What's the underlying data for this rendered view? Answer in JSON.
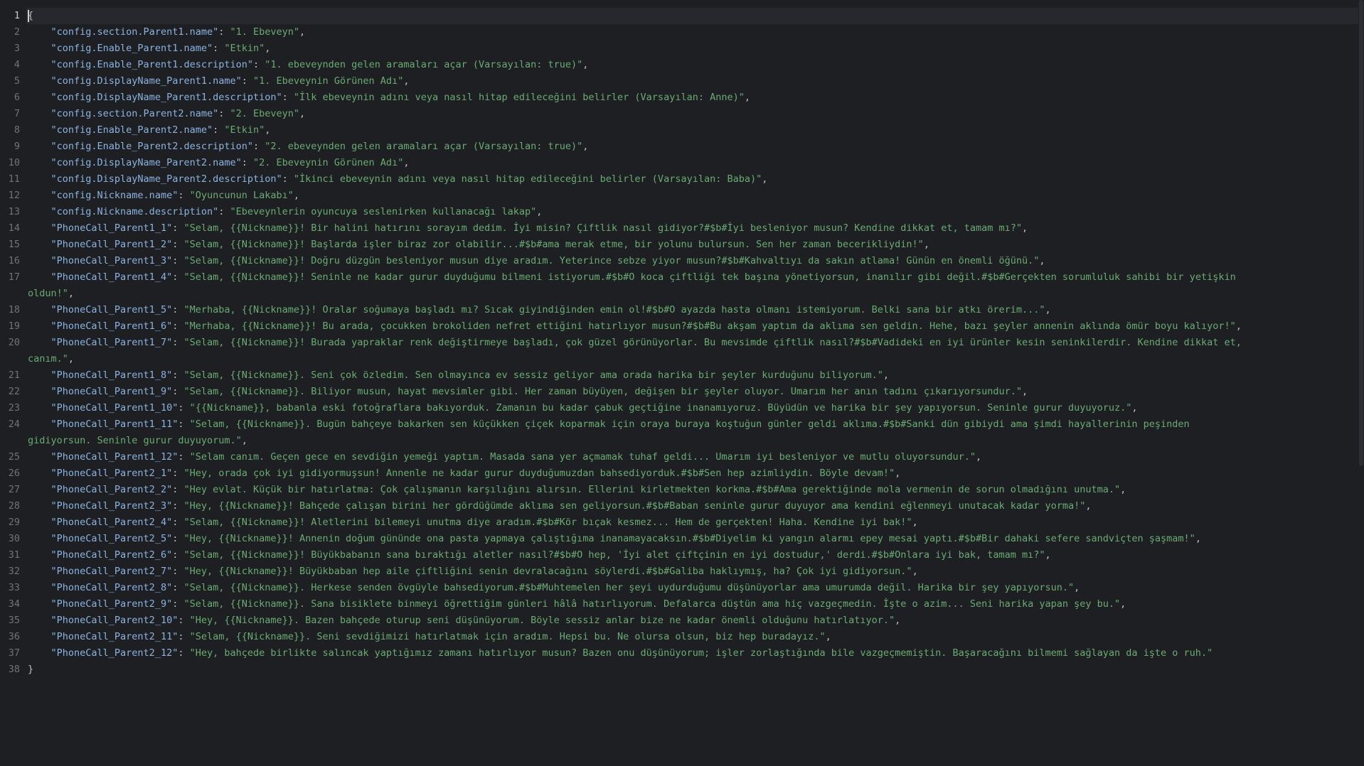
{
  "editor": {
    "lines": [
      {
        "n": "1",
        "indent": "",
        "open": "{"
      },
      {
        "n": "2",
        "indent": "    ",
        "key": "\"config.section.Parent1.name\"",
        "sep": ": ",
        "val": "\"1. Ebeveyn\"",
        "end": ","
      },
      {
        "n": "3",
        "indent": "    ",
        "key": "\"config.Enable_Parent1.name\"",
        "sep": ": ",
        "val": "\"Etkin\"",
        "end": ","
      },
      {
        "n": "4",
        "indent": "    ",
        "key": "\"config.Enable_Parent1.description\"",
        "sep": ": ",
        "val": "\"1. ebeveynden gelen aramaları açar (Varsayılan: true)\"",
        "end": ","
      },
      {
        "n": "5",
        "indent": "    ",
        "key": "\"config.DisplayName_Parent1.name\"",
        "sep": ": ",
        "val": "\"1. Ebeveynin Görünen Adı\"",
        "end": ","
      },
      {
        "n": "6",
        "indent": "    ",
        "key": "\"config.DisplayName_Parent1.description\"",
        "sep": ": ",
        "val": "\"İlk ebeveynin adını veya nasıl hitap edileceğini belirler (Varsayılan: Anne)\"",
        "end": ","
      },
      {
        "n": "7",
        "indent": "    ",
        "key": "\"config.section.Parent2.name\"",
        "sep": ": ",
        "val": "\"2. Ebeveyn\"",
        "end": ","
      },
      {
        "n": "8",
        "indent": "    ",
        "key": "\"config.Enable_Parent2.name\"",
        "sep": ": ",
        "val": "\"Etkin\"",
        "end": ","
      },
      {
        "n": "9",
        "indent": "    ",
        "key": "\"config.Enable_Parent2.description\"",
        "sep": ": ",
        "val": "\"2. ebeveynden gelen aramaları açar (Varsayılan: true)\"",
        "end": ","
      },
      {
        "n": "10",
        "indent": "    ",
        "key": "\"config.DisplayName_Parent2.name\"",
        "sep": ": ",
        "val": "\"2. Ebeveynin Görünen Adı\"",
        "end": ","
      },
      {
        "n": "11",
        "indent": "    ",
        "key": "\"config.DisplayName_Parent2.description\"",
        "sep": ": ",
        "val": "\"İkinci ebeveynin adını veya nasıl hitap edileceğini belirler (Varsayılan: Baba)\"",
        "end": ","
      },
      {
        "n": "12",
        "indent": "    ",
        "key": "\"config.Nickname.name\"",
        "sep": ": ",
        "val": "\"Oyuncunun Lakabı\"",
        "end": ","
      },
      {
        "n": "13",
        "indent": "    ",
        "key": "\"config.Nickname.description\"",
        "sep": ": ",
        "val": "\"Ebeveynlerin oyuncuya seslenirken kullanacağı lakap\"",
        "end": ","
      },
      {
        "n": "14",
        "indent": "    ",
        "key": "\"PhoneCall_Parent1_1\"",
        "sep": ": ",
        "val": "\"Selam, {{Nickname}}! Bir halini hatırını sorayım dedim. İyi misin? Çiftlik nasıl gidiyor?#$b#İyi besleniyor musun? Kendine dikkat et, tamam mı?\"",
        "end": ","
      },
      {
        "n": "15",
        "indent": "    ",
        "key": "\"PhoneCall_Parent1_2\"",
        "sep": ": ",
        "val": "\"Selam, {{Nickname}}! Başlarda işler biraz zor olabilir...#$b#ama merak etme, bir yolunu bulursun. Sen her zaman becerikliydin!\"",
        "end": ","
      },
      {
        "n": "16",
        "indent": "    ",
        "key": "\"PhoneCall_Parent1_3\"",
        "sep": ": ",
        "val": "\"Selam, {{Nickname}}! Doğru düzgün besleniyor musun diye aradım. Yeterince sebze yiyor musun?#$b#Kahvaltıyı da sakın atlama! Günün en önemli öğünü.\"",
        "end": ","
      },
      {
        "n": "17",
        "indent": "    ",
        "key": "\"PhoneCall_Parent1_4\"",
        "sep": ": ",
        "val": "\"Selam, {{Nickname}}! Seninle ne kadar gurur duyduğumu bilmeni istiyorum.#$b#O koca çiftliği tek başına yönetiyorsun, inanılır gibi değil.#$b#Gerçekten sorumluluk sahibi bir yetişkin",
        "end": ""
      },
      {
        "n": "",
        "indent": "",
        "cont": "oldun!\"",
        "end": ","
      },
      {
        "n": "18",
        "indent": "    ",
        "key": "\"PhoneCall_Parent1_5\"",
        "sep": ": ",
        "val": "\"Merhaba, {{Nickname}}! Oralar soğumaya başladı mı? Sıcak giyindiğinden emin ol!#$b#O ayazda hasta olmanı istemiyorum. Belki sana bir atkı örerim...\"",
        "end": ","
      },
      {
        "n": "19",
        "indent": "    ",
        "key": "\"PhoneCall_Parent1_6\"",
        "sep": ": ",
        "val": "\"Merhaba, {{Nickname}}! Bu arada, çocukken brokoliden nefret ettiğini hatırlıyor musun?#$b#Bu akşam yaptım da aklıma sen geldin. Hehe, bazı şeyler annenin aklında ömür boyu kalıyor!\"",
        "end": ","
      },
      {
        "n": "20",
        "indent": "    ",
        "key": "\"PhoneCall_Parent1_7\"",
        "sep": ": ",
        "val": "\"Selam, {{Nickname}}! Burada yapraklar renk değiştirmeye başladı, çok güzel görünüyorlar. Bu mevsimde çiftlik nasıl?#$b#Vadideki en iyi ürünler kesin seninkilerdir. Kendine dikkat et,",
        "end": ""
      },
      {
        "n": "",
        "indent": "",
        "cont": "canım.\"",
        "end": ","
      },
      {
        "n": "21",
        "indent": "    ",
        "key": "\"PhoneCall_Parent1_8\"",
        "sep": ": ",
        "val": "\"Selam, {{Nickname}}. Seni çok özledim. Sen olmayınca ev sessiz geliyor ama orada harika bir şeyler kurduğunu biliyorum.\"",
        "end": ","
      },
      {
        "n": "22",
        "indent": "    ",
        "key": "\"PhoneCall_Parent1_9\"",
        "sep": ": ",
        "val": "\"Selam, {{Nickname}}. Biliyor musun, hayat mevsimler gibi. Her zaman büyüyen, değişen bir şeyler oluyor. Umarım her anın tadını çıkarıyorsundur.\"",
        "end": ","
      },
      {
        "n": "23",
        "indent": "    ",
        "key": "\"PhoneCall_Parent1_10\"",
        "sep": ": ",
        "val": "\"{{Nickname}}, babanla eski fotoğraflara bakıyorduk. Zamanın bu kadar çabuk geçtiğine inanamıyoruz. Büyüdün ve harika bir şey yapıyorsun. Seninle gurur duyuyoruz.\"",
        "end": ","
      },
      {
        "n": "24",
        "indent": "    ",
        "key": "\"PhoneCall_Parent1_11\"",
        "sep": ": ",
        "val": "\"Selam, {{Nickname}}. Bugün bahçeye bakarken sen küçükken çiçek koparmak için oraya buraya koştuğun günler geldi aklıma.#$b#Sanki dün gibiydi ama şimdi hayallerinin peşinden",
        "end": ""
      },
      {
        "n": "",
        "indent": "",
        "cont": "gidiyorsun. Seninle gurur duyuyorum.\"",
        "end": ","
      },
      {
        "n": "25",
        "indent": "    ",
        "key": "\"PhoneCall_Parent1_12\"",
        "sep": ": ",
        "val": "\"Selam canım. Geçen gece en sevdiğin yemeği yaptım. Masada sana yer açmamak tuhaf geldi... Umarım iyi besleniyor ve mutlu oluyorsundur.\"",
        "end": ","
      },
      {
        "n": "26",
        "indent": "    ",
        "key": "\"PhoneCall_Parent2_1\"",
        "sep": ": ",
        "val": "\"Hey, orada çok iyi gidiyormuşsun! Annenle ne kadar gurur duyduğumuzdan bahsediyorduk.#$b#Sen hep azimliydin. Böyle devam!\"",
        "end": ","
      },
      {
        "n": "27",
        "indent": "    ",
        "key": "\"PhoneCall_Parent2_2\"",
        "sep": ": ",
        "val": "\"Hey evlat. Küçük bir hatırlatma: Çok çalışmanın karşılığını alırsın. Ellerini kirletmekten korkma.#$b#Ama gerektiğinde mola vermenin de sorun olmadığını unutma.\"",
        "end": ","
      },
      {
        "n": "28",
        "indent": "    ",
        "key": "\"PhoneCall_Parent2_3\"",
        "sep": ": ",
        "val": "\"Hey, {{Nickname}}! Bahçede çalışan birini her gördüğümde aklıma sen geliyorsun.#$b#Baban seninle gurur duyuyor ama kendini eğlenmeyi unutacak kadar yorma!\"",
        "end": ","
      },
      {
        "n": "29",
        "indent": "    ",
        "key": "\"PhoneCall_Parent2_4\"",
        "sep": ": ",
        "val": "\"Selam, {{Nickname}}! Aletlerini bilemeyi unutma diye aradım.#$b#Kör bıçak kesmez... Hem de gerçekten! Haha. Kendine iyi bak!\"",
        "end": ","
      },
      {
        "n": "30",
        "indent": "    ",
        "key": "\"PhoneCall_Parent2_5\"",
        "sep": ": ",
        "val": "\"Hey, {{Nickname}}! Annenin doğum gününde ona pasta yapmaya çalıştığıma inanamayacaksın.#$b#Diyelim ki yangın alarmı epey mesai yaptı.#$b#Bir dahaki sefere sandviçten şaşmam!\"",
        "end": ","
      },
      {
        "n": "31",
        "indent": "    ",
        "key": "\"PhoneCall_Parent2_6\"",
        "sep": ": ",
        "val": "\"Selam, {{Nickname}}! Büyükbabanın sana bıraktığı aletler nasıl?#$b#O hep, 'İyi alet çiftçinin en iyi dostudur,' derdi.#$b#Onlara iyi bak, tamam mı?\"",
        "end": ","
      },
      {
        "n": "32",
        "indent": "    ",
        "key": "\"PhoneCall_Parent2_7\"",
        "sep": ": ",
        "val": "\"Hey, {{Nickname}}! Büyükbaban hep aile çiftliğini senin devralacağını söylerdi.#$b#Galiba haklıymış, ha? Çok iyi gidiyorsun.\"",
        "end": ","
      },
      {
        "n": "33",
        "indent": "    ",
        "key": "\"PhoneCall_Parent2_8\"",
        "sep": ": ",
        "val": "\"Selam, {{Nickname}}. Herkese senden övgüyle bahsediyorum.#$b#Muhtemelen her şeyi uydurduğumu düşünüyorlar ama umurumda değil. Harika bir şey yapıyorsun.\"",
        "end": ","
      },
      {
        "n": "34",
        "indent": "    ",
        "key": "\"PhoneCall_Parent2_9\"",
        "sep": ": ",
        "val": "\"Selam, {{Nickname}}. Sana bisiklete binmeyi öğrettiğim günleri hâlâ hatırlıyorum. Defalarca düştün ama hiç vazgeçmedin. İşte o azim... Seni harika yapan şey bu.\"",
        "end": ","
      },
      {
        "n": "35",
        "indent": "    ",
        "key": "\"PhoneCall_Parent2_10\"",
        "sep": ": ",
        "val": "\"Hey, {{Nickname}}. Bazen bahçede oturup seni düşünüyorum. Böyle sessiz anlar bize ne kadar önemli olduğunu hatırlatıyor.\"",
        "end": ","
      },
      {
        "n": "36",
        "indent": "    ",
        "key": "\"PhoneCall_Parent2_11\"",
        "sep": ": ",
        "val": "\"Selam, {{Nickname}}. Seni sevdiğimizi hatırlatmak için aradım. Hepsi bu. Ne olursa olsun, biz hep buradayız.\"",
        "end": ","
      },
      {
        "n": "37",
        "indent": "    ",
        "key": "\"PhoneCall_Parent2_12\"",
        "sep": ": ",
        "val": "\"Hey, bahçede birlikte salıncak yaptığımız zamanı hatırlıyor musun? Bazen onu düşünüyorum; işler zorlaştığında bile vazgeçmemiştin. Başaracağını bilmemi sağlayan da işte o ruh.\"",
        "end": ""
      },
      {
        "n": "38",
        "indent": "",
        "open": "}"
      }
    ]
  }
}
